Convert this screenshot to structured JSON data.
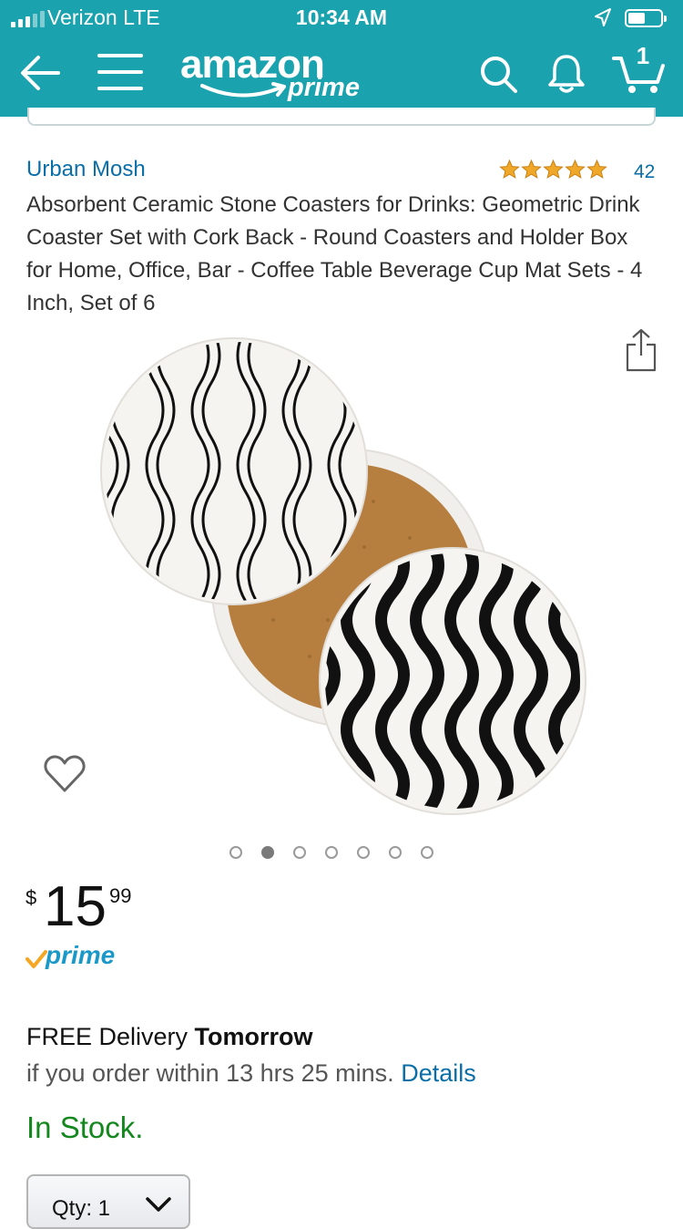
{
  "status_bar": {
    "carrier": "Verizon  LTE",
    "time": "10:34 AM",
    "signal_icon": "signal-bars-icon",
    "location_icon": "location-arrow-icon",
    "battery_icon": "battery-icon"
  },
  "nav": {
    "logo_word": "amazon",
    "logo_prime": "prime",
    "cart_count": "1",
    "icons": [
      "back-arrow-icon",
      "menu-icon",
      "search-icon",
      "bell-icon",
      "cart-icon"
    ],
    "bar_color": "#1aa2ae"
  },
  "product": {
    "brand": "Urban Mosh",
    "rating_stars": 5,
    "review_count": "42",
    "title": "Absorbent Ceramic Stone Coasters for Drinks: Geometric Drink Coaster Set with Cork Back - Round Coasters and Holder Box for Home, Office, Bar - Coffee Table Beverage Cup Mat Sets - 4 Inch, Set of 6",
    "image_count": 7,
    "active_image_index": 1
  },
  "price": {
    "currency": "$",
    "whole": "15",
    "fraction": "99",
    "badge": "prime"
  },
  "delivery": {
    "prefix": "FREE Delivery ",
    "day": "Tomorrow",
    "condition": "if you order within 13 hrs 25 mins.",
    "details_link": "Details"
  },
  "availability": "In Stock.",
  "quantity": {
    "label": "Qty:  1"
  },
  "colors": {
    "link": "#0a6ea8",
    "in_stock": "#14881e",
    "star": "#f0a82a"
  }
}
